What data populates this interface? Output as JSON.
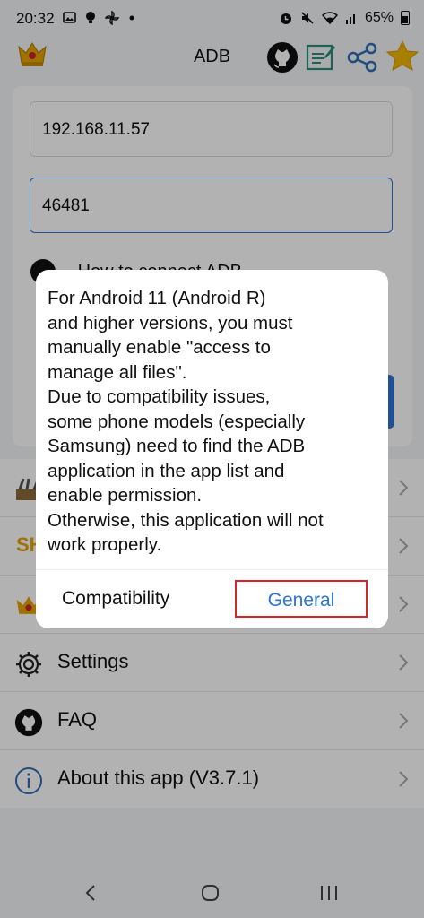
{
  "status_bar": {
    "time": "20:32",
    "battery": "65%",
    "icons": [
      "image-icon",
      "bulb-icon",
      "pinwheel-icon",
      "dot-icon",
      "alarm-icon",
      "mute-icon",
      "wifi-icon",
      "signal-icon",
      "battery-icon"
    ]
  },
  "app_bar": {
    "title": "ADB",
    "icons": [
      "crown-icon",
      "github-icon",
      "notes-icon",
      "share-icon",
      "star-icon"
    ]
  },
  "connection": {
    "ip_value": "192.168.11.57",
    "port_value": "46481",
    "partial_row_text": "How to connect ADB"
  },
  "menu": {
    "items": [
      {
        "label": "",
        "icon": "tools-icon"
      },
      {
        "label": "SH",
        "icon": "shell-icon"
      },
      {
        "label": "",
        "icon": "crown-icon"
      },
      {
        "label": "Settings",
        "icon": "gear-icon"
      },
      {
        "label": "FAQ",
        "icon": "github-icon"
      },
      {
        "label": "About this app (V3.7.1)",
        "icon": "info-icon"
      }
    ]
  },
  "dialog": {
    "message": "For Android 11 (Android R)\nand higher versions, you must\nmanually enable \"access to\nmanage all files\".\nDue to compatibility issues,\nsome phone models (especially\nSamsung) need to find the ADB\napplication in the app list and\nenable permission.\nOtherwise, this application will not\nwork properly.",
    "buttons": {
      "secondary": "Compatibility",
      "primary": "General"
    }
  },
  "nav_bar": {
    "icons": [
      "back-icon",
      "home-icon",
      "recents-icon"
    ]
  },
  "colors": {
    "accent": "#2f75d1",
    "highlight": "#d6262d",
    "star": "#f2b600",
    "notes": "#2e8b7a"
  }
}
